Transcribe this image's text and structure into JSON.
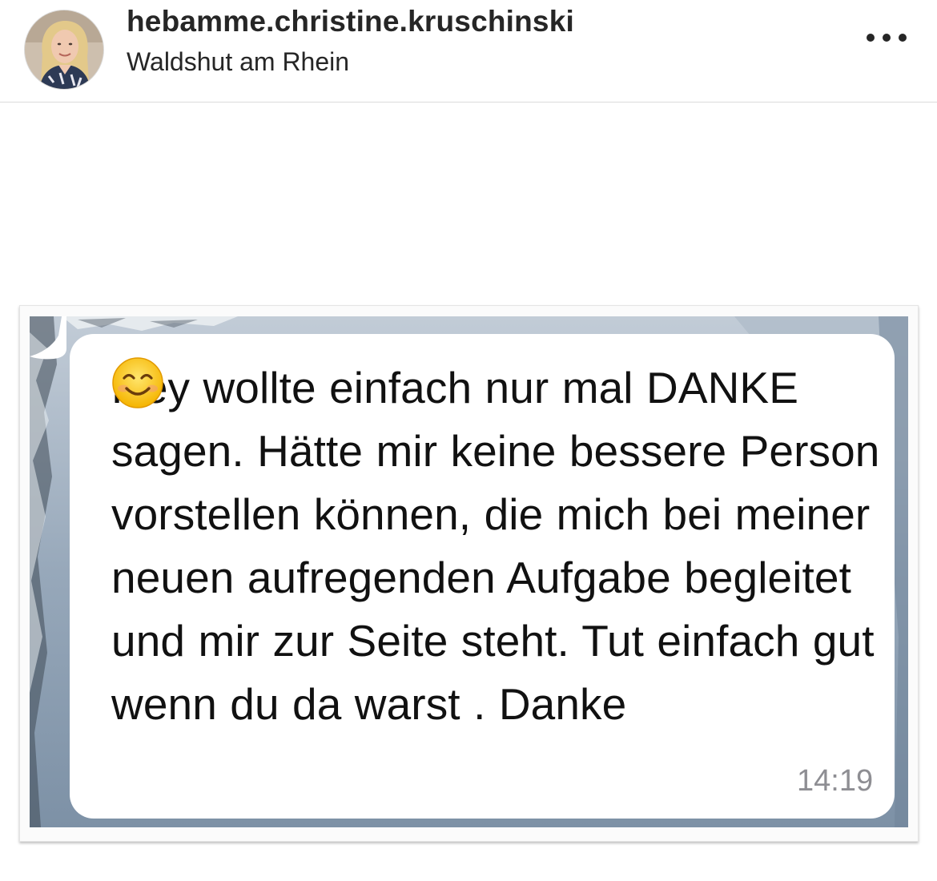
{
  "post": {
    "username": "hebamme.christine.kruschinski",
    "location": "Waldshut am Rhein",
    "avatar_icon": "profile-photo",
    "more_icon": "more-options-icon"
  },
  "chat": {
    "message_text": "Hey wollte einfach nur mal DANKE sagen. Hätte mir keine bessere Person vorstellen können, die mich bei meiner neuen aufregenden Aufgabe begleitet und mir zur Seite steht. Tut einfach gut wenn du da warst . Danke",
    "emoji": "smiling-face-with-smiling-eyes",
    "time": "14:19"
  },
  "colors": {
    "text": "#262626",
    "divider": "#dbdbdb",
    "bubble": "#ffffff",
    "timestamp": "#8e8e93",
    "emoji": "#f5b400"
  }
}
